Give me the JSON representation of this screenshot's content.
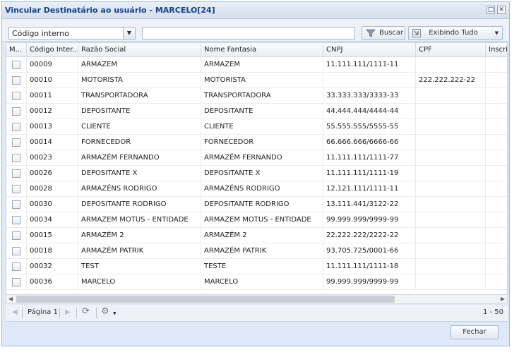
{
  "window": {
    "title": "Vincular Destinatário ao usuário - MARCELO[24]",
    "restore_glyph": "□",
    "close_glyph": "✕"
  },
  "toolbar": {
    "filter_field": "Código interno",
    "search_value": "",
    "search_label": "Buscar",
    "view_label": "Exibindo Tudo"
  },
  "grid": {
    "columns": [
      "M...",
      "Código Inter...",
      "Razão Social",
      "Nome Fantasia",
      "CNPJ",
      "CPF",
      "Inscri"
    ],
    "rows": [
      {
        "codigo": "00009",
        "razao": "ARMAZEM",
        "fantasia": "ARMAZEM",
        "cnpj": "11.111.111/1111-11",
        "cpf": ""
      },
      {
        "codigo": "00010",
        "razao": "MOTORISTA",
        "fantasia": "MOTORISTA",
        "cnpj": "",
        "cpf": "222.222.222-22"
      },
      {
        "codigo": "00011",
        "razao": "TRANSPORTADORA",
        "fantasia": "TRANSPORTADORA",
        "cnpj": "33.333.333/3333-33",
        "cpf": ""
      },
      {
        "codigo": "00012",
        "razao": "DEPOSITANTE",
        "fantasia": "DEPOSITANTE",
        "cnpj": "44.444.444/4444-44",
        "cpf": ""
      },
      {
        "codigo": "00013",
        "razao": "CLIENTE",
        "fantasia": "CLIENTE",
        "cnpj": "55.555.555/5555-55",
        "cpf": ""
      },
      {
        "codigo": "00014",
        "razao": "FORNECEDOR",
        "fantasia": "FORNECEDOR",
        "cnpj": "66.666.666/6666-66",
        "cpf": ""
      },
      {
        "codigo": "00023",
        "razao": "ARMAZÉM FERNANDO",
        "fantasia": "ARMAZÉM FERNANDO",
        "cnpj": "11.111.111/1111-77",
        "cpf": ""
      },
      {
        "codigo": "00026",
        "razao": "DEPOSITANTE X",
        "fantasia": "DEPOSITANTE X",
        "cnpj": "11.111.111/1111-19",
        "cpf": ""
      },
      {
        "codigo": "00028",
        "razao": "ARMAZÉNS RODRIGO",
        "fantasia": "ARMAZÉNS RODRIGO",
        "cnpj": "12.121.111/1111-11",
        "cpf": ""
      },
      {
        "codigo": "00030",
        "razao": "DEPOSITANTE RODRIGO",
        "fantasia": "DEPOSITANTE RODRIGO",
        "cnpj": "13.111.441/3122-22",
        "cpf": ""
      },
      {
        "codigo": "00034",
        "razao": "ARMAZEM MOTUS - ENTIDADE",
        "fantasia": "ARMAZEM MOTUS - ENTIDADE",
        "cnpj": "99.999.999/9999-99",
        "cpf": ""
      },
      {
        "codigo": "00015",
        "razao": "ARMAZÉM 2",
        "fantasia": "ARMAZÉM 2",
        "cnpj": "22.222.222/2222-22",
        "cpf": ""
      },
      {
        "codigo": "00018",
        "razao": "ARMAZÉM PATRIK",
        "fantasia": "ARMAZÉM PATRIK",
        "cnpj": "93.705.725/0001-66",
        "cpf": ""
      },
      {
        "codigo": "00032",
        "razao": "TEST",
        "fantasia": "TESTE",
        "cnpj": "11.111.111/1111-18",
        "cpf": ""
      },
      {
        "codigo": "00036",
        "razao": "MARCELO",
        "fantasia": "MARCELO",
        "cnpj": "99.999.999/9999-99",
        "cpf": ""
      }
    ]
  },
  "pager": {
    "page_label": "Página 1",
    "range": "1 - 50"
  },
  "footer": {
    "close_label": "Fechar"
  },
  "icons": {
    "first": "◀",
    "next": "▶",
    "scroll_left": "◀",
    "scroll_right": "▶",
    "dropdown": "▼",
    "refresh": "⟳",
    "settings": "⚙"
  }
}
